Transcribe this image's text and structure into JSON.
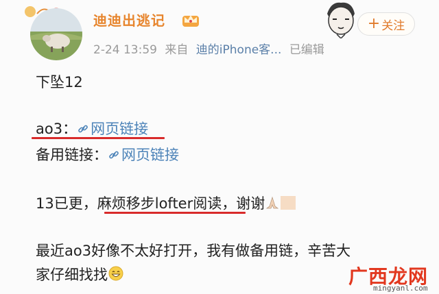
{
  "post": {
    "username": "迪迪出逃记",
    "date": "2-24 13:59",
    "source_prefix": "来自",
    "source": "迪的iPhone客...",
    "edited": "已编辑",
    "follow_label": "关注",
    "follow_plus": "+",
    "lines": {
      "l1": "下坠12",
      "l2_label": "ao3：",
      "l2_link": "网页链接",
      "l3_label": "备用链接：",
      "l3_link": "网页链接",
      "l4_a": "13已更，",
      "l4_b": "麻烦移步lofter阅读",
      "l4_c": "，谢谢",
      "l5": "最近ao3好像不太好打开，我有做备用链，辛苦大",
      "l6": "家仔细找找"
    }
  },
  "watermark": {
    "name": "广西龙网",
    "url": "mingyanl.com"
  },
  "colors": {
    "username": "#e7852d",
    "link": "#4c83b8",
    "highlight_underline": "#d82a2a",
    "watermark": "#e2381f"
  },
  "icons": [
    "crown-icon",
    "link-icon",
    "praying-hands-icon",
    "smile-icon",
    "plus-icon"
  ]
}
